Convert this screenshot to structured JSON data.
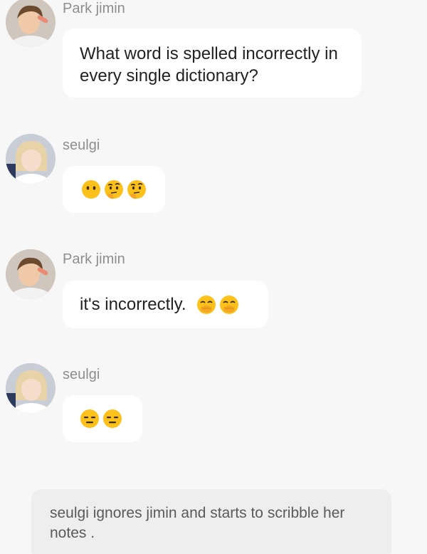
{
  "messages": [
    {
      "sender": "Park jimin",
      "avatar_icon": "jimin-avatar",
      "text": "What word is spelled incorrectly in every single dictionary?",
      "emojis": []
    },
    {
      "sender": "seulgi",
      "avatar_icon": "seulgi-avatar",
      "text": "",
      "emojis": [
        "neutral-face-no-mouth-emoji",
        "thinking-face-emoji",
        "thinking-face-emoji"
      ]
    },
    {
      "sender": "Park jimin",
      "avatar_icon": "jimin-avatar",
      "text": "it's incorrectly.",
      "emojis": [
        "hand-over-mouth-emoji",
        "hand-over-mouth-emoji"
      ]
    },
    {
      "sender": "seulgi",
      "avatar_icon": "seulgi-avatar",
      "text": "",
      "emojis": [
        "expressionless-face-emoji",
        "expressionless-face-emoji"
      ]
    }
  ],
  "narration": {
    "text": "seulgi ignores jimin and starts to scribble her notes ."
  },
  "colors": {
    "background": "#f7f7f7",
    "bubble": "#ffffff",
    "narration_bg": "#eeeeee",
    "sender_name": "#8e8e8e",
    "emoji_yellow": "#fcc21b"
  }
}
